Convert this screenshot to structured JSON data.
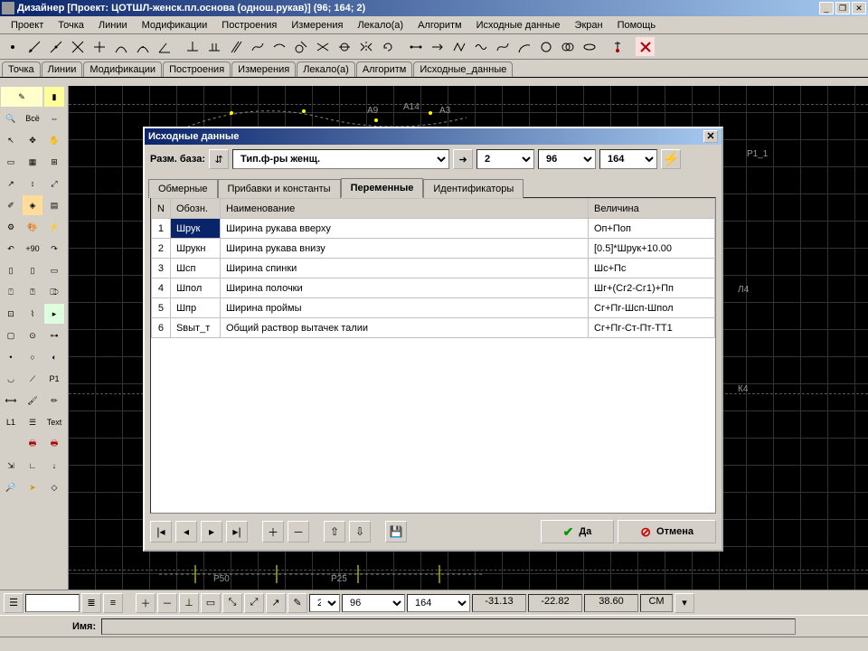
{
  "window": {
    "title": "Дизайнер  [Проект: ЦОТШЛ-женск.пл.основа (однош.рукав)]   (96; 164; 2)",
    "min": "_",
    "max": "❐",
    "close": "✕"
  },
  "menu": [
    "Проект",
    "Точка",
    "Линии",
    "Модификации",
    "Построения",
    "Измерения",
    "Лекало(а)",
    "Алгоритм",
    "Исходные данные",
    "Экран",
    "Помощь"
  ],
  "tabs": [
    "Точка",
    "Линии",
    "Модификации",
    "Построения",
    "Измерения",
    "Лекало(а)",
    "Алгоритм",
    "Исходные_данные"
  ],
  "canvasLabels": {
    "a9": "А9",
    "а14": "А14",
    "a3": "А3",
    "p11": "Р1_1",
    "l4": "Л4",
    "k4": "К4",
    "p50": "P50",
    "p25": "Р25"
  },
  "dialog": {
    "title": "Исходные данные",
    "sizeBaseLabel": "Разм. база:",
    "figureType": "Тип.ф-ры женщ.",
    "combo2": "2",
    "combo96": "96",
    "combo164": "164",
    "tabs": {
      "t1": "Обмерные",
      "t2": "Прибавки и константы",
      "t3": "Переменные",
      "t4": "Идентификаторы"
    },
    "headers": {
      "n": "N",
      "code": "Обозн.",
      "name": "Наименование",
      "val": "Величина"
    },
    "rows": [
      {
        "n": "1",
        "code": "Шрук",
        "name": "Ширина рукава вверху",
        "val": "Оп+Поп"
      },
      {
        "n": "2",
        "code": "Шрукн",
        "name": "Ширина рукава внизу",
        "val": "[0.5]*Шрук+10.00"
      },
      {
        "n": "3",
        "code": "Шсп",
        "name": "Ширина спинки",
        "val": "Шс+Пс"
      },
      {
        "n": "4",
        "code": "Шпол",
        "name": "Ширина полочки",
        "val": "Шг+(Сг2-Сг1)+Пп"
      },
      {
        "n": "5",
        "code": "Шпр",
        "name": "Ширина проймы",
        "val": "Сг+Пг-Шсп-Шпол"
      },
      {
        "n": "6",
        "code": "Sвыт_т",
        "name": "Общий раствор вытачек талии",
        "val": "Сг+Пг-Ст-Пт-ТТ1"
      }
    ],
    "okLabel": "Да",
    "cancelLabel": "Отмена"
  },
  "status": {
    "v2": "2",
    "v96": "96",
    "v164": "164",
    "coord1": "-31.13",
    "coord2": "-22.82",
    "coord3": "38.60",
    "unit": "СМ",
    "nameLabel": "Имя:"
  }
}
